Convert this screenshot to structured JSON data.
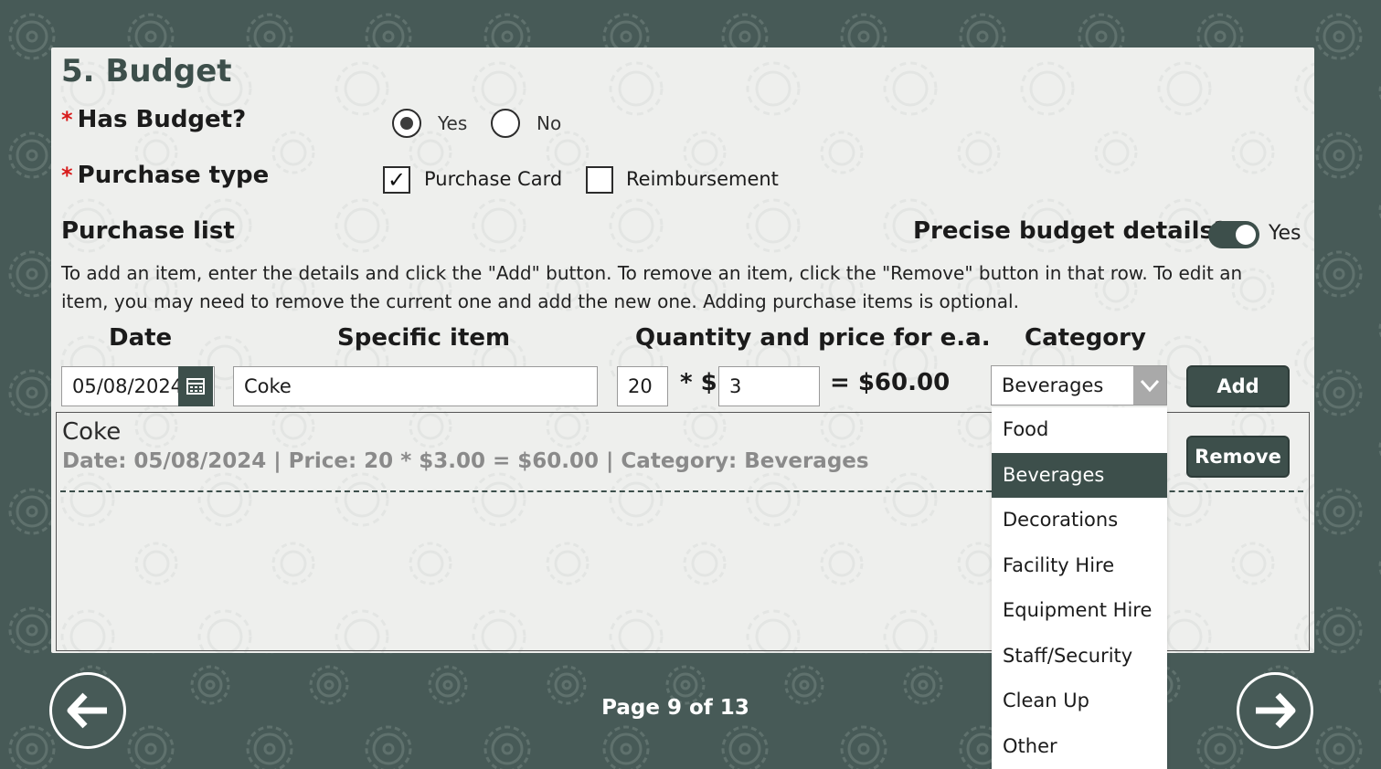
{
  "section": {
    "title": "5. Budget"
  },
  "has_budget": {
    "required_mark": "*",
    "label": "Has Budget?",
    "options": [
      {
        "label": "Yes",
        "selected": true
      },
      {
        "label": "No",
        "selected": false
      }
    ]
  },
  "purchase_type": {
    "required_mark": "*",
    "label": "Purchase type",
    "options": [
      {
        "label": "Purchase Card",
        "checked": true,
        "mark": "✓"
      },
      {
        "label": "Reimbursement",
        "checked": false
      }
    ]
  },
  "purchase_list": {
    "label": "Purchase list"
  },
  "precise": {
    "label": "Precise budget details?",
    "value_label": "Yes",
    "on": true
  },
  "instructions": "To add an item, enter the details and click the \"Add\" button. To remove an item, click the \"Remove\" button in that row. To edit an item, you may need to remove the current one and add the new one. Adding purchase items is optional.",
  "columns": {
    "date": "Date",
    "item": "Specific item",
    "qty_price": "Quantity and price for e.a.",
    "category": "Category"
  },
  "form": {
    "date": "05/08/2024",
    "item": "Coke",
    "quantity": "20",
    "times_dollar": "* $",
    "price": "3",
    "total": "= $60.00",
    "category": "Beverages",
    "add_label": "Add"
  },
  "items": [
    {
      "name": "Coke",
      "detail": "Date: 05/08/2024 | Price: 20 * $3.00 = $60.00 | Category: Beverages",
      "remove_label": "Remove"
    }
  ],
  "category_options": [
    "Food",
    "Beverages",
    "Decorations",
    "Facility Hire",
    "Equipment Hire",
    "Staff/Security",
    "Clean Up",
    "Other"
  ],
  "selected_category": "Beverages",
  "footer": {
    "page": "Page 9 of 13"
  },
  "icons": {
    "prev": "arrow-left-icon",
    "next": "arrow-right-icon",
    "calendar": "calendar-icon",
    "dropdown": "chevron-down-icon"
  },
  "colors": {
    "accent": "#3d4f4b",
    "background": "#475a57",
    "panel": "#eeefed",
    "required": "#d81b1b"
  }
}
